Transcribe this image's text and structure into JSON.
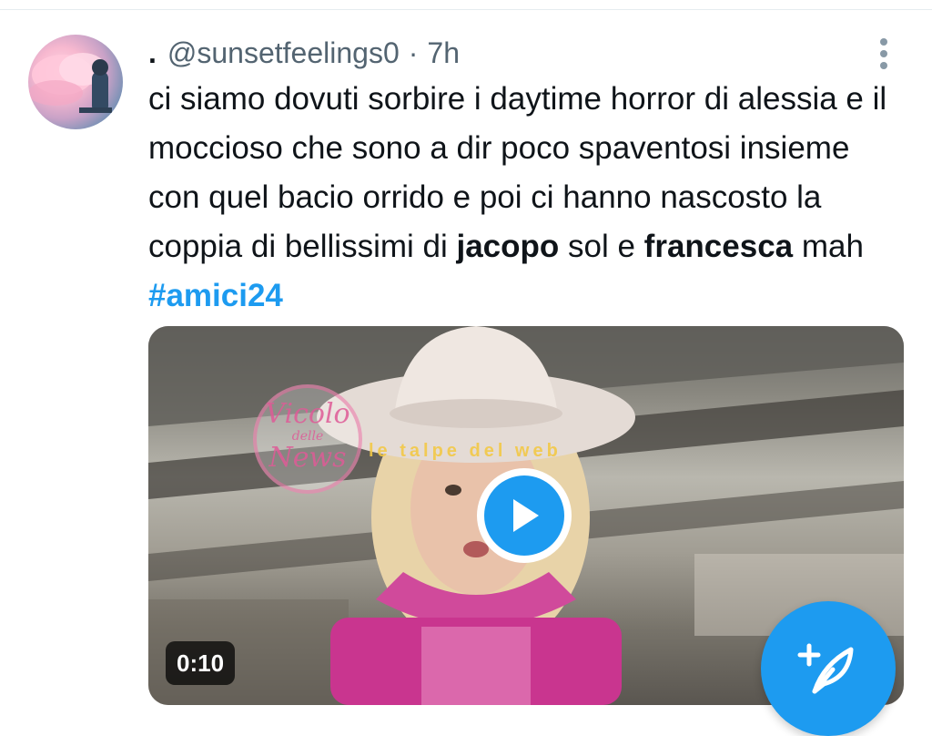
{
  "tweet": {
    "author_prefix": ".",
    "handle": "@sunsetfeelings0",
    "separator": "·",
    "time": "7h",
    "text_segments": {
      "s1": "ci siamo dovuti sorbire i daytime horror di alessia e il moccioso che sono a dir poco spaventosi insieme con quel bacio orrido e poi ci hanno nascosto la coppia di bellissimi di ",
      "s2": "jacopo",
      "s3": " sol e ",
      "s4": "francesca",
      "s5": " mah ",
      "s6": "#amici24"
    }
  },
  "media": {
    "duration": "0:10",
    "watermark_left_line1": "Vicolo",
    "watermark_left_line2": "delle",
    "watermark_left_line3": "News",
    "watermark_right": "le talpe del web"
  },
  "icons": {
    "more": "more-vertical-icon",
    "play": "play-icon",
    "compose": "compose-feather-icon"
  },
  "colors": {
    "accent": "#1d9bf0",
    "text": "#0f1419",
    "secondary": "#536471"
  }
}
